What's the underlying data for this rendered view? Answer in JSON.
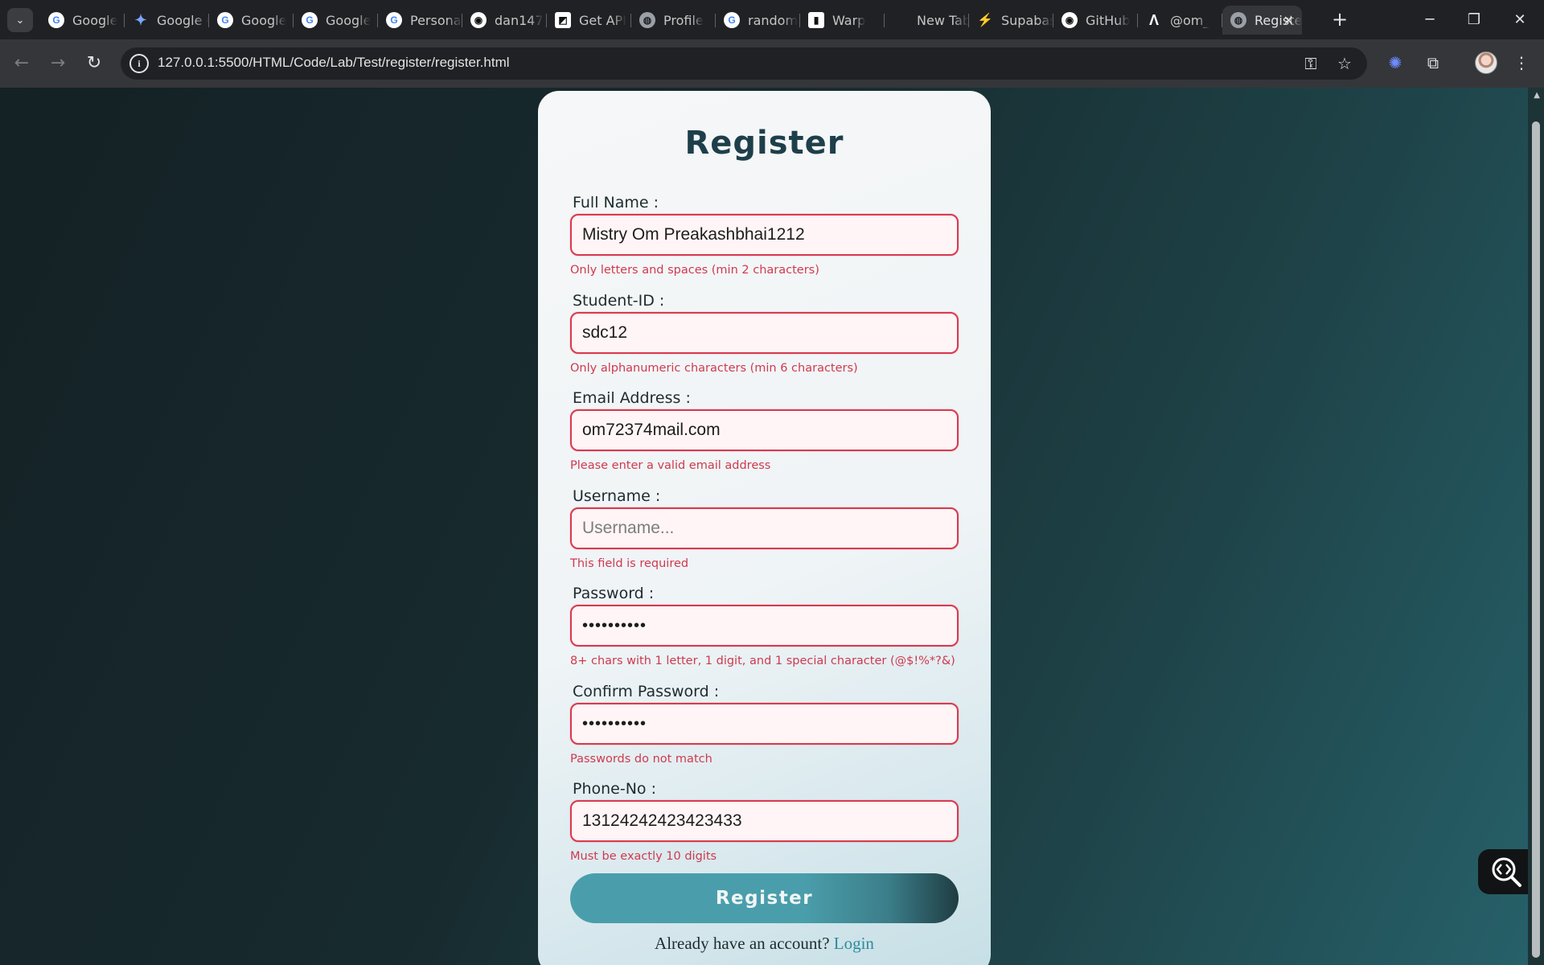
{
  "browser": {
    "tabs": [
      {
        "label": "Google",
        "icon": "google-icon"
      },
      {
        "label": "Google Gemini",
        "icon": "gemini-icon"
      },
      {
        "label": "Google",
        "icon": "google-icon"
      },
      {
        "label": "Google",
        "icon": "google-icon"
      },
      {
        "label": "Personal",
        "icon": "google-icon"
      },
      {
        "label": "dan147",
        "icon": "github-icon"
      },
      {
        "label": "Get API",
        "icon": "api-icon"
      },
      {
        "label": "Profile",
        "icon": "globe-icon"
      },
      {
        "label": "random",
        "icon": "google-icon"
      },
      {
        "label": "Warp",
        "icon": "warp-icon"
      },
      {
        "label": "New Tab",
        "icon": "blank-icon"
      },
      {
        "label": "Supabase",
        "icon": "supabase-icon"
      },
      {
        "label": "GitHub",
        "icon": "github-icon"
      },
      {
        "label": "@om_",
        "icon": "lambda-icon"
      }
    ],
    "active_tab": {
      "label": "Register",
      "icon": "globe-icon"
    },
    "url": "127.0.0.1:5500/HTML/Code/Lab/Test/register/register.html"
  },
  "form": {
    "title": "Register",
    "fields": [
      {
        "label": "Full Name :",
        "value": "Mistry Om Preakashbhai1212",
        "placeholder": "",
        "error": "Only letters and spaces (min 2 characters)"
      },
      {
        "label": "Student-ID :",
        "value": "sdc12",
        "placeholder": "",
        "error": "Only alphanumeric characters (min 6 characters)"
      },
      {
        "label": "Email Address :",
        "value": "om72374mail.com",
        "placeholder": "",
        "error": "Please enter a valid email address"
      },
      {
        "label": "Username :",
        "value": "",
        "placeholder": "Username...",
        "error": "This field is required"
      },
      {
        "label": "Password :",
        "value": "••••••••••",
        "placeholder": "",
        "error": "8+ chars with 1 letter, 1 digit, and 1 special character (@$!%*?&)"
      },
      {
        "label": "Confirm Password :",
        "value": "••••••••••",
        "placeholder": "",
        "error": "Passwords do not match"
      },
      {
        "label": "Phone-No :",
        "value": "13124242423423433",
        "placeholder": "",
        "error": "Must be exactly 10 digits"
      }
    ],
    "submit_label": "Register",
    "account_prompt": "Already have an account?",
    "login_label": "Login"
  },
  "colors": {
    "error": "#d0394e",
    "accent": "#4a9eab",
    "title": "#1e3f4a",
    "link": "#2f8a9e"
  }
}
